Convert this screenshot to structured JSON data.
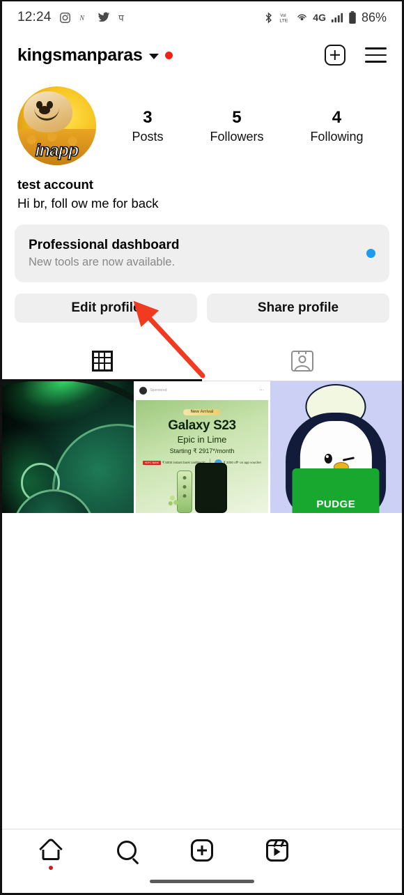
{
  "status_bar": {
    "time": "12:24",
    "left_icons": [
      "instagram-icon",
      "snapchat-icon",
      "twitter-icon",
      "phonepe-icon"
    ],
    "right_icons": [
      "bluetooth-icon",
      "volte-icon",
      "hotspot-icon"
    ],
    "network": "4G",
    "battery": "86%"
  },
  "header": {
    "username": "kingsmanparas",
    "chevron": "chevron-down-icon",
    "has_new_badge": true,
    "new_post_icon": "plus-square-icon",
    "menu_icon": "hamburger-menu-icon"
  },
  "profile": {
    "avatar_text": "inapp",
    "stats": [
      {
        "num": "3",
        "label": "Posts"
      },
      {
        "num": "5",
        "label": "Followers"
      },
      {
        "num": "4",
        "label": "Following"
      }
    ],
    "display_name": "test account",
    "bio": "Hi br, foll ow me for back"
  },
  "dashboard": {
    "title": "Professional dashboard",
    "subtitle": "New tools are now available.",
    "indicator_color": "#1b9cf0"
  },
  "actions": {
    "edit_profile": "Edit profile",
    "share_profile": "Share profile"
  },
  "tabs": [
    {
      "name": "grid-tab",
      "icon": "grid-icon",
      "active": true
    },
    {
      "name": "tagged-tab",
      "icon": "tagged-person-icon",
      "active": false
    }
  ],
  "posts": [
    {
      "id": "post-1",
      "alt": "green abstract wallpaper with glowing circles"
    },
    {
      "id": "post-2",
      "alt": "Galaxy S23 sponsored advertisement",
      "sponsored_label": "Sponsored",
      "badge": "New Arrival",
      "headline": "Galaxy S23",
      "subhead": "Epic in Lime",
      "price": "Starting ₹ 2917*/month",
      "offer_1_bank": "HDFC BANK",
      "offer_1": "₹ 5000 instant bank cashback*",
      "offer_2": "₹ 2000 off* on app voucher"
    },
    {
      "id": "post-3",
      "alt": "Pudgy penguin with egg on head",
      "caption": "PUDGE"
    }
  ],
  "annotation": {
    "type": "arrow",
    "color": "#f03b21",
    "points_to": "edit-profile-button"
  },
  "bottom_nav": [
    {
      "name": "home-tab",
      "icon": "home-icon",
      "badge": true
    },
    {
      "name": "search-tab",
      "icon": "search-icon",
      "badge": false
    },
    {
      "name": "create-tab",
      "icon": "plus-square-icon",
      "badge": false
    },
    {
      "name": "reels-tab",
      "icon": "reels-icon",
      "badge": false
    }
  ]
}
